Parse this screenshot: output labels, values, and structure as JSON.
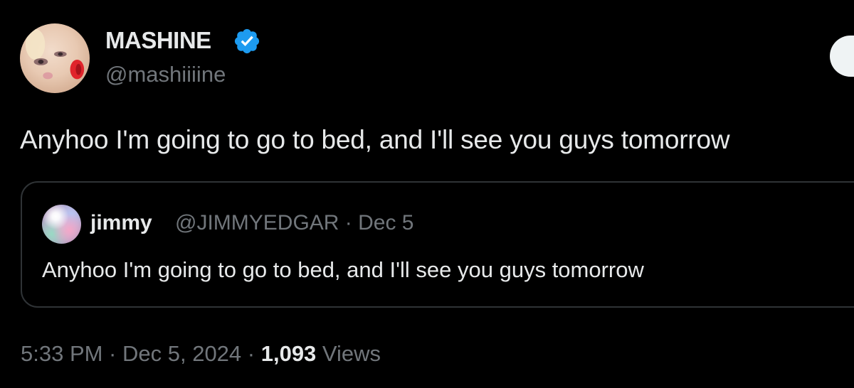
{
  "author": {
    "display_name": "MASHINE",
    "handle": "@mashiiiine",
    "verified_icon": "verified-badge-icon",
    "verified_color": "#1d9bf0"
  },
  "tweet": {
    "text": "Anyhoo I'm going to go to bed, and I'll see you guys tomorrow"
  },
  "quoted_tweet": {
    "display_name": "jimmy",
    "meta": "@JIMMYEDGAR · Dec 5",
    "text": "Anyhoo I'm going to go to bed, and I'll see you guys tomorrow"
  },
  "footer": {
    "time_date": "5:33 PM · Dec 5, 2024 · ",
    "views_count": "1,093",
    "views_label": " Views"
  },
  "colors": {
    "background": "#000000",
    "primary_text": "#e7e9ea",
    "secondary_text": "#71767b",
    "border": "#2f3336"
  }
}
